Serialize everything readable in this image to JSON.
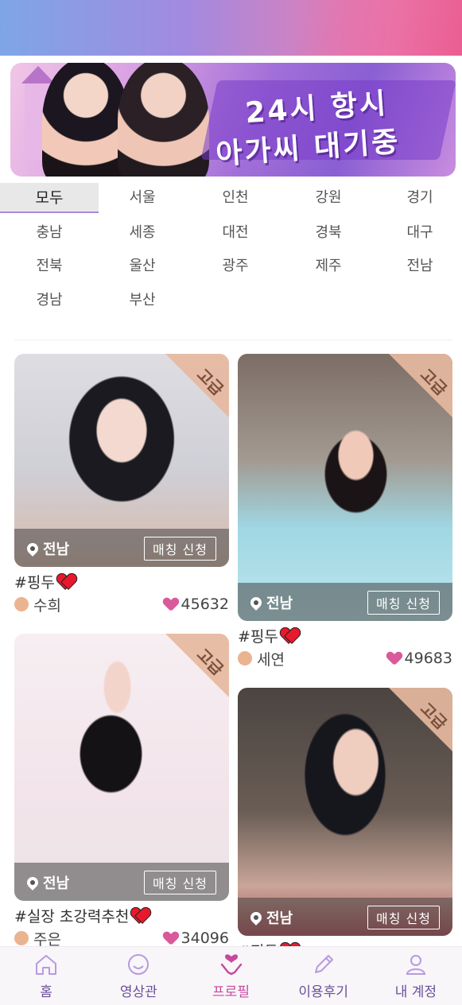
{
  "banner": {
    "line1": "24시 항시",
    "line2": "아가씨 대기중"
  },
  "regions": [
    "모두",
    "서울",
    "인천",
    "강원",
    "경기",
    "충남",
    "세종",
    "대전",
    "경북",
    "대구",
    "전북",
    "울산",
    "광주",
    "제주",
    "전남",
    "경남",
    "부산"
  ],
  "active_region": "모두",
  "cards": [
    {
      "badge": "고급",
      "location": "전남",
      "apply_label": "매칭 신청",
      "tag": "#핑두",
      "name": "수희",
      "likes": "45632"
    },
    {
      "badge": "고급",
      "location": "전남",
      "apply_label": "매칭 신청",
      "tag": "#핑두",
      "name": "세연",
      "likes": "49683"
    },
    {
      "badge": "고급",
      "location": "전남",
      "apply_label": "매칭 신청",
      "tag": "#실장 초강력추천",
      "name": "주은",
      "likes": "34096"
    },
    {
      "badge": "고급",
      "location": "전남",
      "apply_label": "매칭 신청",
      "tag": "#핑두"
    }
  ],
  "nav": [
    {
      "label": "홈",
      "icon": "home-icon"
    },
    {
      "label": "영상관",
      "icon": "smile-icon"
    },
    {
      "label": "프로필",
      "icon": "hand-heart-icon"
    },
    {
      "label": "이용후기",
      "icon": "pencil-icon"
    },
    {
      "label": "내 계정",
      "icon": "user-icon"
    }
  ],
  "colors": {
    "accent": "#c54a9e",
    "nav_text": "#6b4f9a",
    "badge": "#e6b9a0",
    "like": "#d95a9a",
    "red_heart": "#e8192c"
  }
}
